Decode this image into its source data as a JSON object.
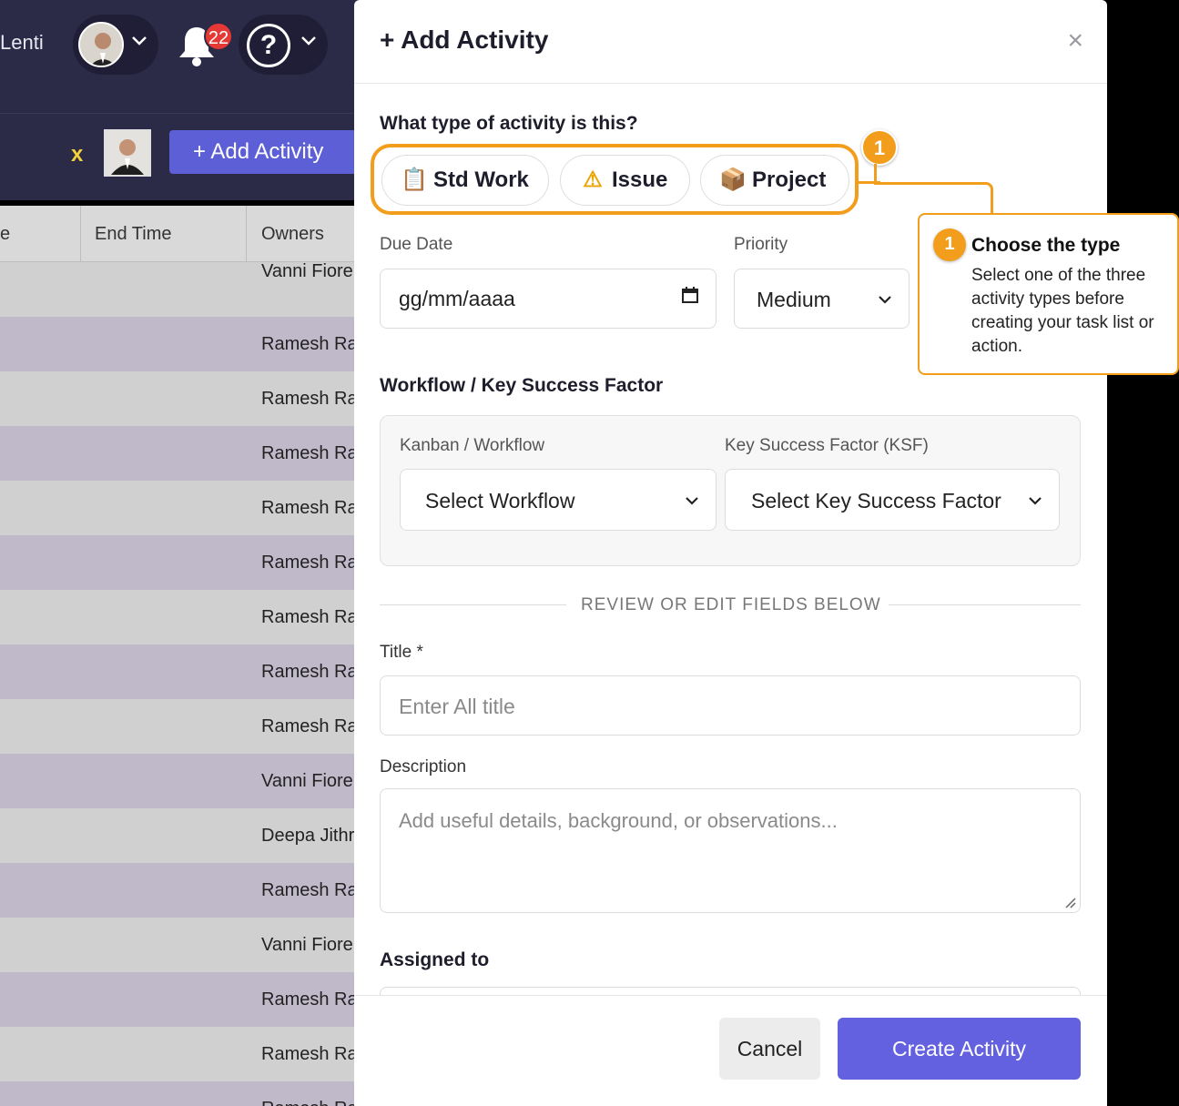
{
  "header": {
    "user_name": "Lenti",
    "notification_count": "22",
    "help_glyph": "?"
  },
  "toolbar": {
    "clear_filter_label": "x",
    "add_activity_label": "+ Add Activity"
  },
  "table": {
    "columns": [
      "e",
      "End Time",
      "Owners"
    ],
    "rows": [
      {
        "owner": "Vanni Fiore"
      },
      {
        "owner": "Ramesh Ra"
      },
      {
        "owner": "Ramesh Ra"
      },
      {
        "owner": "Ramesh Ra"
      },
      {
        "owner": "Ramesh Ra"
      },
      {
        "owner": "Ramesh Ra"
      },
      {
        "owner": "Ramesh Ra"
      },
      {
        "owner": "Ramesh Ra"
      },
      {
        "owner": "Ramesh Ra"
      },
      {
        "owner": "Vanni Fiore"
      },
      {
        "owner": "Deepa Jithr"
      },
      {
        "owner": "Ramesh Ra"
      },
      {
        "owner": "Vanni Fiore"
      },
      {
        "owner": "Ramesh Ra"
      },
      {
        "owner": "Ramesh Ra"
      },
      {
        "owner": "Ramesh Ra"
      }
    ]
  },
  "modal": {
    "title": "+ Add Activity",
    "close_glyph": "×",
    "type_question": "What type of activity is this?",
    "types": [
      {
        "label": "Std Work",
        "icon": "clipboard-icon",
        "glyph": "📋"
      },
      {
        "label": "Issue",
        "icon": "warning-icon",
        "glyph": "⚠"
      },
      {
        "label": "Project",
        "icon": "package-icon",
        "glyph": "📦"
      }
    ],
    "step_badge": "1",
    "due_date": {
      "label": "Due Date",
      "placeholder": "gg/mm/aaaa"
    },
    "priority": {
      "label": "Priority",
      "value": "Medium"
    },
    "workflow_section": "Workflow / Key Success Factor",
    "kanban": {
      "label": "Kanban / Workflow",
      "value": "Select Workflow"
    },
    "ksf": {
      "label": "Key Success Factor (KSF)",
      "value": "Select Key Success Factor"
    },
    "divider": "REVIEW OR EDIT FIELDS BELOW",
    "title_field": {
      "label": "Title *",
      "placeholder": "Enter All title"
    },
    "description": {
      "label": "Description",
      "placeholder": "Add useful details, background, or observations..."
    },
    "assigned_to": "Assigned to",
    "cancel_label": "Cancel",
    "create_label": "Create Activity"
  },
  "tooltip": {
    "step": "1",
    "title": "Choose the type",
    "body": "Select one of the three activity types before creating your task list or action."
  },
  "colors": {
    "accent_orange": "#f29d1b",
    "primary_button": "#6361e0",
    "topbar": "#2b2a47"
  }
}
